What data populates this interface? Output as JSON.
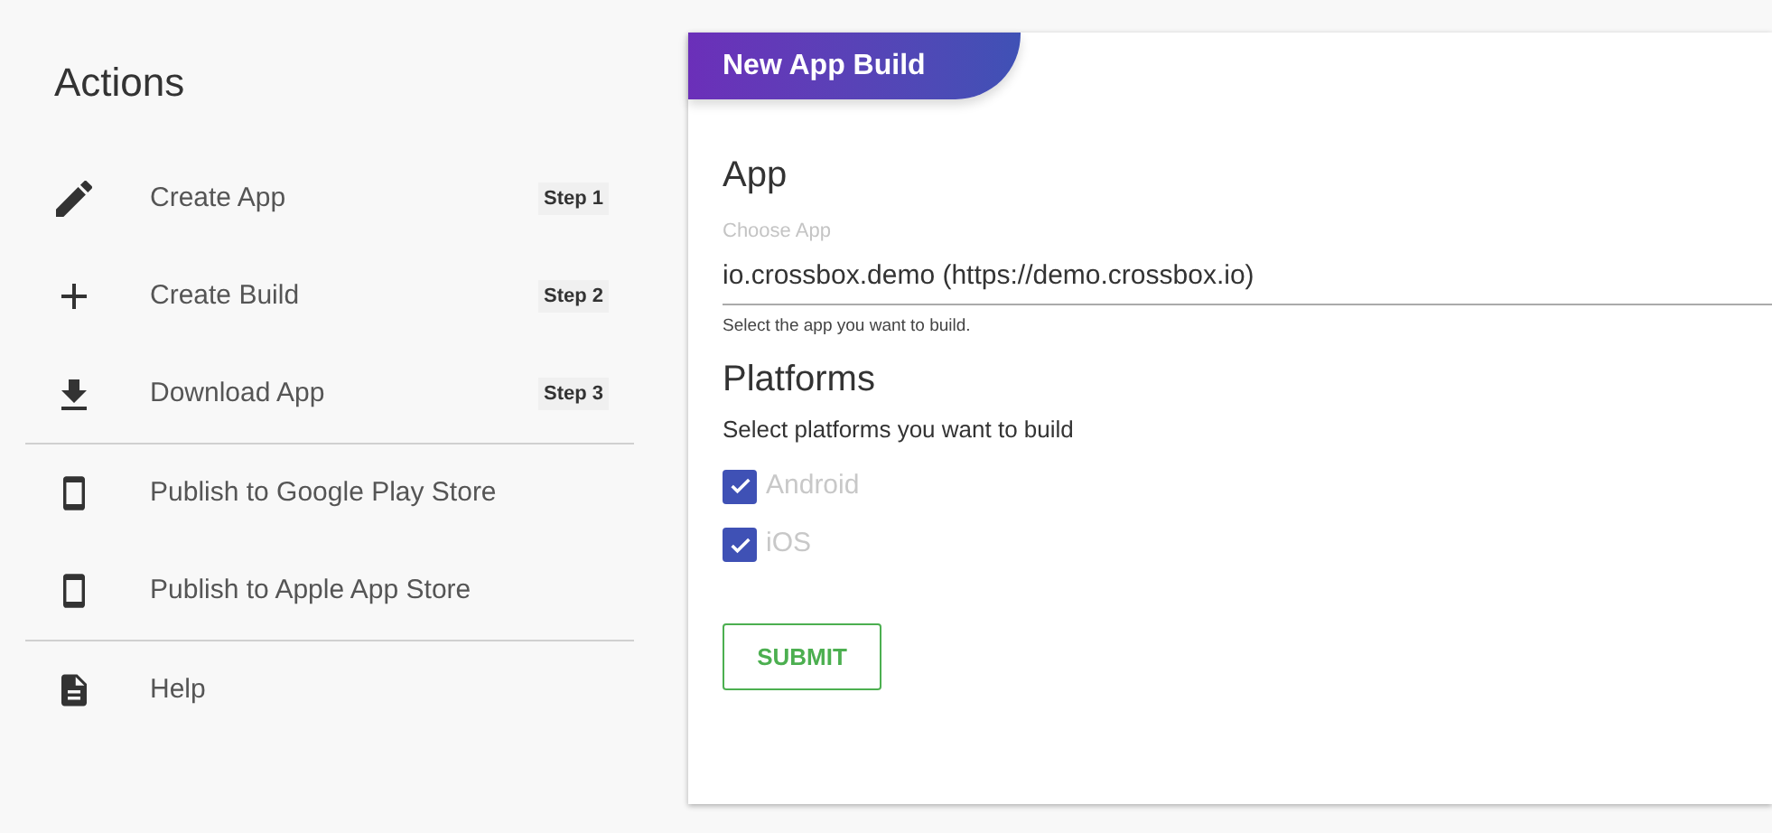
{
  "sidebar": {
    "title": "Actions",
    "groups": [
      [
        {
          "kind": "edit",
          "label": "Create App",
          "step": "Step 1"
        },
        {
          "kind": "add",
          "label": "Create Build",
          "step": "Step 2"
        },
        {
          "kind": "download",
          "label": "Download App",
          "step": "Step 3"
        }
      ],
      [
        {
          "kind": "phone",
          "label": "Publish to Google Play Store"
        },
        {
          "kind": "phone",
          "label": "Publish to Apple App Store"
        }
      ],
      [
        {
          "kind": "document",
          "label": "Help"
        }
      ]
    ]
  },
  "card": {
    "title": "New App Build",
    "app_section": {
      "heading": "App",
      "field": {
        "label": "Choose App",
        "value": "io.crossbox.demo (https://demo.crossbox.io)",
        "helper": "Select the app you want to build."
      }
    },
    "platforms_section": {
      "heading": "Platforms",
      "subtitle": "Select platforms you want to build",
      "options": [
        {
          "label": "Android",
          "checked": true,
          "disabled": true
        },
        {
          "label": "iOS",
          "checked": true,
          "disabled": true
        }
      ]
    },
    "submit": "SUBMIT"
  }
}
